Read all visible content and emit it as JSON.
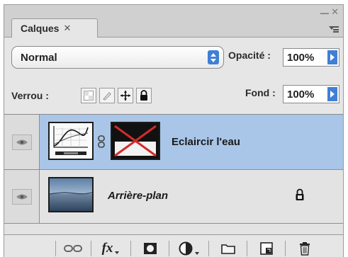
{
  "panel": {
    "tab_label": "Calques",
    "tab_close": "✕",
    "minimize": "–",
    "close": "✕"
  },
  "blend_mode": {
    "value": "Normal"
  },
  "opacity": {
    "label": "Opacité :",
    "value": "100%"
  },
  "lock": {
    "label": "Verrou :",
    "icons": [
      "lock-transparent-pixels-icon",
      "lock-image-pixels-icon",
      "lock-position-icon",
      "lock-all-icon"
    ]
  },
  "fill": {
    "label": "Fond :",
    "value": "100%"
  },
  "layers": [
    {
      "name": "Eclaircir l'eau",
      "selected": true,
      "type": "adjustment-curves",
      "has_mask": true,
      "visible": true
    },
    {
      "name": "Arrière-plan",
      "selected": false,
      "type": "image",
      "locked": true,
      "visible": true
    }
  ],
  "footer_buttons": [
    "link-layers-icon",
    "layer-style-fx-icon",
    "add-mask-icon",
    "new-adjustment-layer-icon",
    "new-group-icon",
    "new-layer-icon",
    "delete-layer-icon"
  ],
  "footer_fx_label": "fx",
  "colors": {
    "selection": "#a9c6e8",
    "accent_blue": "#3f7fd6",
    "panel_bg": "#e6e6e6"
  }
}
